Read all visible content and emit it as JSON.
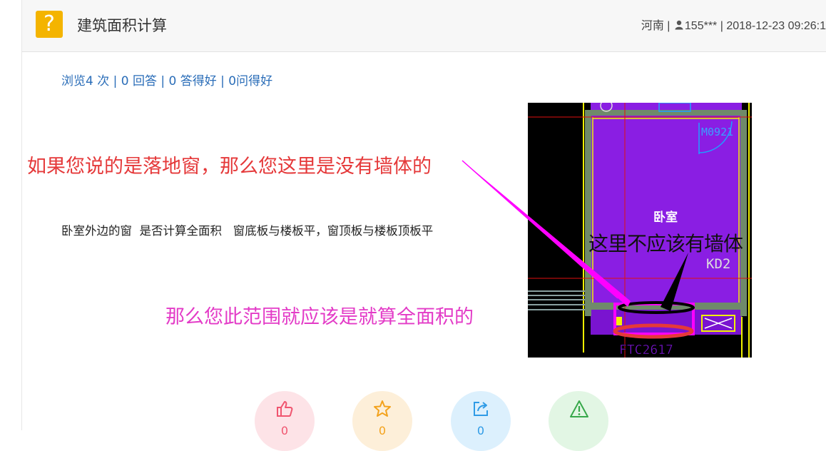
{
  "header": {
    "title": "建筑面积计算",
    "badge_glyph": "?",
    "location": "河南",
    "user": "155***",
    "datetime": "2018-12-23 09:26:1",
    "separator": "|"
  },
  "stats": {
    "text": "浏览4 次 | 0 回答 | 0 答得好 | 0问得好"
  },
  "question": {
    "text": "卧室外边的窗  是否计算全面积   窗底板与楼板平，窗顶板与楼板顶板平"
  },
  "image": {
    "annotations": {
      "red_note": "如果您说的是落地窗，那么您这里是没有墙体的",
      "magenta_note": "那么您此范围就应该是就算全面积的",
      "black_note": "这里不应该有墙体"
    },
    "cad_labels": {
      "door": "M0921",
      "room": "卧室",
      "kd": "KD2",
      "window": "FTC2617"
    }
  },
  "actions": [
    {
      "name": "like",
      "icon": "thumbs-up-icon",
      "count": "0",
      "bg": "#fde3e7",
      "fg": "#f0556f"
    },
    {
      "name": "favorite",
      "icon": "star-icon",
      "count": "0",
      "bg": "#fdefd9",
      "fg": "#f3a21c"
    },
    {
      "name": "share",
      "icon": "share-icon",
      "count": "0",
      "bg": "#dcf0fd",
      "fg": "#2f9be6"
    },
    {
      "name": "report",
      "icon": "warning-icon",
      "count": "",
      "bg": "#e2f6e4",
      "fg": "#37a84a"
    }
  ],
  "colors": {
    "accent": "#f4b400",
    "link": "#2a6db8",
    "annotation_red": "#e5393a",
    "annotation_magenta": "#e33bc7"
  }
}
